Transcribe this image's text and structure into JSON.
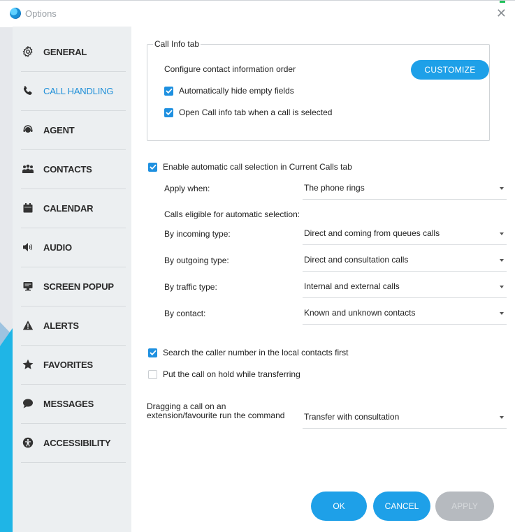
{
  "window": {
    "title": "Options"
  },
  "sidebar": {
    "items": [
      {
        "label": "GENERAL",
        "icon": "gear-icon"
      },
      {
        "label": "CALL HANDLING",
        "icon": "phone-icon",
        "active": true
      },
      {
        "label": "AGENT",
        "icon": "headset-icon"
      },
      {
        "label": "CONTACTS",
        "icon": "people-icon"
      },
      {
        "label": "CALENDAR",
        "icon": "calendar-icon"
      },
      {
        "label": "AUDIO",
        "icon": "speaker-icon"
      },
      {
        "label": "SCREEN POPUP",
        "icon": "monitor-icon"
      },
      {
        "label": "ALERTS",
        "icon": "warning-icon"
      },
      {
        "label": "FAVORITES",
        "icon": "star-icon"
      },
      {
        "label": "MESSAGES",
        "icon": "chat-bubble-icon"
      },
      {
        "label": "ACCESSIBILITY",
        "icon": "accessibility-icon"
      }
    ]
  },
  "callinfo": {
    "legend": "Call Info tab",
    "configure_label": "Configure contact information order",
    "customize_label": "CUSTOMIZE",
    "hide_empty_label": "Automatically hide empty fields",
    "hide_empty_checked": true,
    "open_tab_label": "Open Call info tab when a call is selected",
    "open_tab_checked": true
  },
  "auto_select": {
    "label": "Enable automatic call selection in Current Calls tab",
    "checked": true,
    "apply_when_label": "Apply when:",
    "apply_when_value": "The phone rings",
    "eligible_label": "Calls eligible for automatic selection:",
    "incoming_label": "By incoming type:",
    "incoming_value": "Direct and coming from queues calls",
    "outgoing_label": "By outgoing type:",
    "outgoing_value": "Direct and consultation calls",
    "traffic_label": "By traffic type:",
    "traffic_value": "Internal and external calls",
    "contact_label": "By contact:",
    "contact_value": "Known and unknown contacts"
  },
  "search_local": {
    "label": "Search the caller number in the local contacts first",
    "checked": true
  },
  "hold_transfer": {
    "label": "Put the call on hold while transferring",
    "checked": false
  },
  "drag": {
    "label_line1": "Dragging a call on an",
    "label_line2": "extension/favourite run the command",
    "value": "Transfer with consultation"
  },
  "buttons": {
    "ok": "OK",
    "cancel": "CANCEL",
    "apply": "APPLY"
  },
  "colors": {
    "accent": "#1ea0e8",
    "active_nav": "#1e8fd8",
    "checkbox": "#1e90e0",
    "disabled": "#b6babf"
  }
}
